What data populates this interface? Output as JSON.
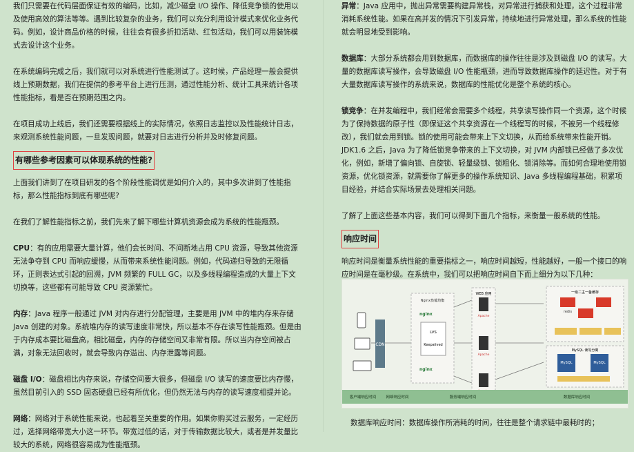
{
  "left": {
    "p1": "我们只需要在代码层面保证有效的编码，比如，减少磁盘 I/O 操作、降低竞争锁的使用以及使用高效的算法等等。遇到比较复杂的业务，我们可以充分利用设计模式来优化业务代码。例如，设计商品价格的时候，往往会有很多折扣活动、红包活动，我们可以用装饰模式去设计这个业务。",
    "p2": "在系统编码完成之后，我们就可以对系统进行性能测试了。这时候，产品经理一般会提供线上预期数据，我们在提供的参考平台上进行压测，通过性能分析、统计工具来统计各项性能指标，看是否在预期范围之内。",
    "p3": "在项目成功上线后，我们还需要根据线上的实际情况，依照日志监控以及性能统计日志，来观测系统性能问题，一旦发现问题，就要对日志进行分析并及时修复问题。",
    "heading": "有哪些参考因素可以体现系统的性能?",
    "p4": "上面我们讲到了在项目研发的各个阶段性能调优是如何介入的，其中多次讲到了性能指标，那么性能指标到底有哪些呢?",
    "p5": "在我们了解性能指标之前，我们先来了解下哪些计算机资源会成为系统的性能瓶颈。",
    "cpu_term": "CPU",
    "cpu_text": "：有的应用需要大量计算，他们会长时间、不间断地占用 CPU 资源，导致其他资源无法争夺到 CPU 而响应缓慢，从而带来系统性能问题。例如，代码递归导致的无限循环，正则表达式引起的回溯，JVM 频繁的 FULL GC，以及多线程编程造成的大量上下文切换等，这些都有可能导致 CPU 资源繁忙。",
    "mem_term": "内存",
    "mem_text": "：Java 程序一般通过 JVM 对内存进行分配管理，主要是用 JVM 中的堆内存来存储 Java 创建的对象。系统堆内存的读写速度非常快，所以基本不存在读写性能瓶颈。但是由于内存成本要比磁盘高，相比磁盘，内存的存储空间又非常有限。所以当内存空间被占满，对象无法回收时，就会导致内存溢出、内存泄露等问题。",
    "disk_term": "磁盘 I/O",
    "disk_text": "：磁盘相比内存来说，存储空间要大很多，但磁盘 I/O 读写的速度要比内存慢，虽然目前引入的 SSD 固态硬盘已经有所优化，但仍然无法与内存的读写速度相提并论。",
    "net_term": "网络",
    "net_text": "：网络对于系统性能来说，也起着至关重要的作用。如果你购买过云服务，一定经历过，选择网络带宽大小这一环节。带宽过低的话，对于传输数据比较大，或者是并发量比较大的系统，网络很容易成为性能瓶颈。"
  },
  "right": {
    "exc_term": "异常",
    "exc_text": "：Java 应用中，抛出异常需要构建异常栈，对异常进行捕获和处理，这个过程非常消耗系统性能。如果在高并发的情况下引发异常，持续地进行异常处理，那么系统的性能就会明显地受到影响。",
    "db_term": "数据库",
    "db_text": "：大部分系统都会用到数据库，而数据库的操作往往是涉及到磁盘 I/O 的读写。大量的数据库读写操作，会导致磁盘 I/O 性能瓶颈，进而导致数据库操作的延迟性。对于有大量数据库读写操作的系统来说，数据库的性能优化是整个系统的核心。",
    "lock_term": "锁竞争",
    "lock_text": "：在并发编程中，我们经常会需要多个线程，共享读写操作同一个资源，这个时候为了保持数据的原子性（即保证这个共享资源在一个线程写的时候，不被另一个线程修改），我们就会用到锁。锁的使用可能会带来上下文切换，从而给系统带来性能开销。JDK1.6 之后，Java 为了降低锁竞争带来的上下文切换，对 JVM 内部锁已经做了多次优化，例如，新增了偏向锁、自旋锁、轻量级锁、锁粗化、锁消除等。而如何合理地使用锁资源，优化锁资源，就需要你了解更多的操作系统知识、Java 多线程编程基础，积累项目经验，并结合实际场景去处理相关问题。",
    "p_summary": "了解了上面这些基本内容，我们可以得到下面几个指标，来衡量一般系统的性能。",
    "heading2": "响应时间",
    "p_resp": "响应时间是衡量系统性能的重要指标之一，响应时间越短，性能越好，一般一个接口的响应时间是在毫秒级。在系统中，我们可以把响应时间自下而上细分为以下几种：",
    "caption": "数据库响应时间：数据库操作所消耗的时间，往往是整个请求链中最耗时的；"
  },
  "diagram": {
    "client_label": "客户端响应时间",
    "network_label": "网络响应时间",
    "server_label": "服务端响应时间",
    "db_label": "数据库响应时间",
    "nginx_box_title": "Nginx负载均衡",
    "web_box_title": "WEB 应用",
    "cache_box_title": "一级二主一备缓存",
    "db_box_title": "MySQL 读写分离",
    "lvs_label": "LVS",
    "keepalived_label": "Keepalived",
    "nginx_text": "nginx",
    "apache_text": "Apache",
    "redis_text": "redis",
    "mysql_text": "MySQL",
    "cdn_text": "CDN"
  }
}
